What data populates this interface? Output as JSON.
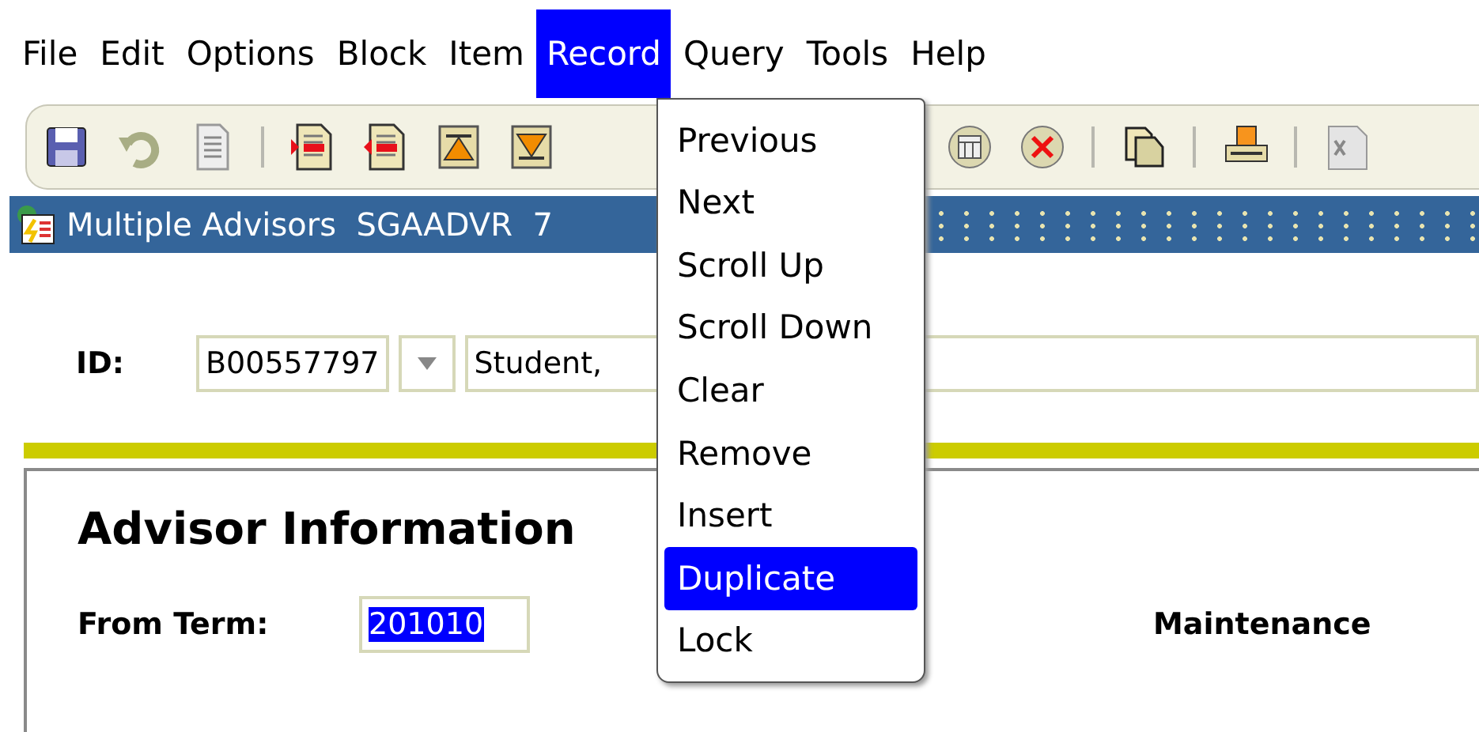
{
  "menu_bar": [
    {
      "label": "File",
      "selected": false
    },
    {
      "label": "Edit",
      "selected": false
    },
    {
      "label": "Options",
      "selected": false
    },
    {
      "label": "Block",
      "selected": false
    },
    {
      "label": "Item",
      "selected": false
    },
    {
      "label": "Record",
      "selected": true
    },
    {
      "label": "Query",
      "selected": false
    },
    {
      "label": "Tools",
      "selected": false
    },
    {
      "label": "Help",
      "selected": false
    }
  ],
  "form_title": {
    "title": "Multiple Advisors",
    "code": "SGAADVR",
    "suffix": "7"
  },
  "key_block": {
    "id_label": "ID:",
    "id_value": "B00557797",
    "name_value": "Student,"
  },
  "section": {
    "title": "Advisor Information",
    "from_term_label": "From Term:",
    "from_term_value": "201010",
    "maintenance_label": "Maintenance"
  },
  "record_menu": [
    {
      "label": "Previous",
      "selected": false
    },
    {
      "label": "Next",
      "selected": false
    },
    {
      "label": "Scroll Up",
      "selected": false
    },
    {
      "label": "Scroll Down",
      "selected": false
    },
    {
      "label": "Clear",
      "selected": false
    },
    {
      "label": "Remove",
      "selected": false
    },
    {
      "label": "Insert",
      "selected": false
    },
    {
      "label": "Duplicate",
      "selected": true
    },
    {
      "label": "Lock",
      "selected": false
    }
  ]
}
